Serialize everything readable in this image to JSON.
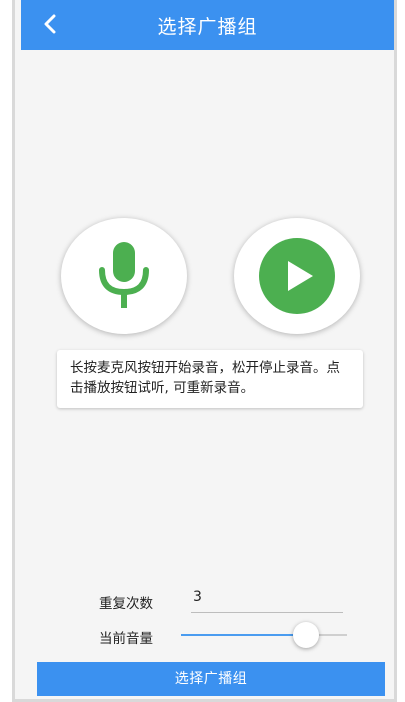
{
  "header": {
    "title": "选择广播组",
    "back_icon": "chevron-left-icon",
    "color": "#3b91f0"
  },
  "record": {
    "mic_icon": "microphone-icon",
    "mic_color": "#4caf50",
    "play_icon": "play-icon",
    "play_color": "#4caf50"
  },
  "tip": {
    "text": "长按麦克风按钮开始录音，松开停止录音。点击播放按钮试听, 可重新录音。"
  },
  "settings": {
    "repeat_label": "重复次数",
    "repeat_value": "3",
    "volume_label": "当前音量",
    "volume_level": 0.75
  },
  "footer": {
    "button_label": "选择广播组"
  }
}
